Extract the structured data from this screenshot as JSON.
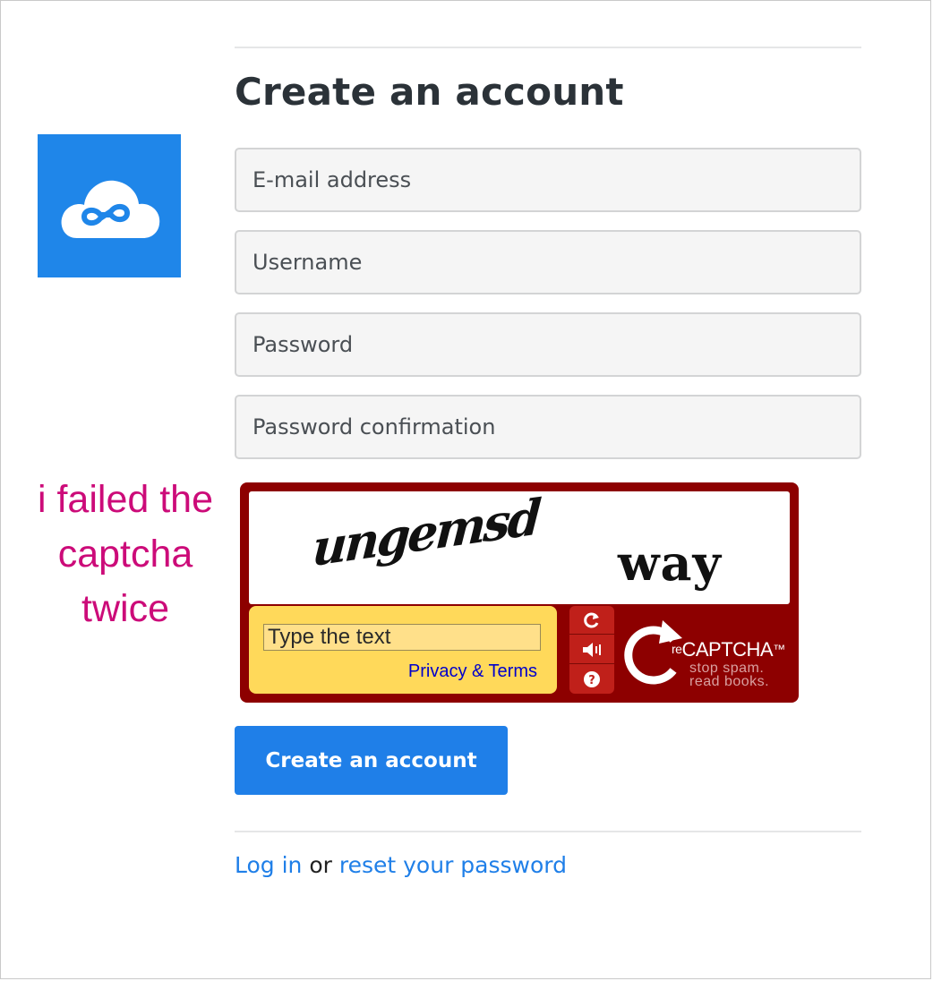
{
  "page": {
    "title": "Create an account"
  },
  "logo": {
    "icon": "cloud-infinity-icon",
    "background": "#1f86e9"
  },
  "form": {
    "email_placeholder": "E-mail address",
    "username_placeholder": "Username",
    "password_placeholder": "Password",
    "password_confirmation_placeholder": "Password confirmation",
    "submit_label": "Create an account"
  },
  "annotation": {
    "lines": [
      "i failed the",
      "captcha",
      "twice"
    ],
    "color": "#cc0b79"
  },
  "captcha": {
    "challenge_words": [
      "ungemsd",
      "way"
    ],
    "input_placeholder": "Type the text",
    "privacy_link": "Privacy & Terms",
    "brand_prefix": "re",
    "brand_name": "CAPTCHA",
    "brand_tm": "™",
    "tagline": [
      "stop spam.",
      "read books."
    ],
    "controls": [
      "refresh-icon",
      "audio-icon",
      "help-icon"
    ],
    "frame_color": "#8d0000",
    "input_bg": "#ffd95a"
  },
  "footer": {
    "login_link": "Log in",
    "separator": "or",
    "reset_link": "reset your password"
  },
  "colors": {
    "accent": "#1f7fe8",
    "heading": "#2b3238"
  }
}
